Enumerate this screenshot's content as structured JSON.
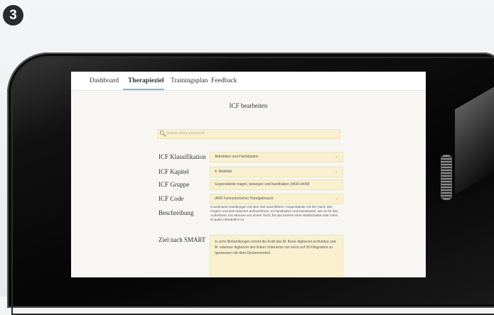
{
  "step_number": "3",
  "nav": {
    "tabs": [
      "Dashboard",
      "Therapieziel",
      "Trainingsplan",
      "Feedback"
    ],
    "active_tab": "Therapieziel"
  },
  "page": {
    "title": "ICF bearbeiten",
    "search_placeholder": "Search using a keyword"
  },
  "form": {
    "klassifikation": {
      "label": "ICF Klassifikation",
      "value": "Aktivitäten und Partizipation"
    },
    "kapitel": {
      "label": "ICF Kapitel",
      "value": "4. Mobilität"
    },
    "gruppe": {
      "label": "ICF Gruppe",
      "value": "Gegenstände tragen, bewegen und handhaben (d430-d449)"
    },
    "code": {
      "label": "ICF Code",
      "value": "d440 Feinmotorischer Handgebrauch"
    },
    "beschreibung": {
      "label": "Beschreibung",
      "value": "Koordinierte Handlungen mit dem Ziel auszuführen, Gegenstände mit der Hand, den Fingern und dem Daumen aufzunehmen, zu handhaben und loszulassen, wie es für das Aufnehmen von Münzen von einem Tisch, für das Drehen einer Wählscheibe oder eines Knaufes erforderlich ist"
    },
    "smart": {
      "label": "Ziel nach SMART",
      "value": "In zehn Behandlungen nimmt die Kraft des M. flexor digitorum profundus und M. extensor digitorum des linken Unterarms von neun auf 20 Kilogramm zu (gemessen mit dem Dynamometer)"
    }
  },
  "icons": {
    "search": "search-icon",
    "dropdown": "chevron-down-icon"
  }
}
